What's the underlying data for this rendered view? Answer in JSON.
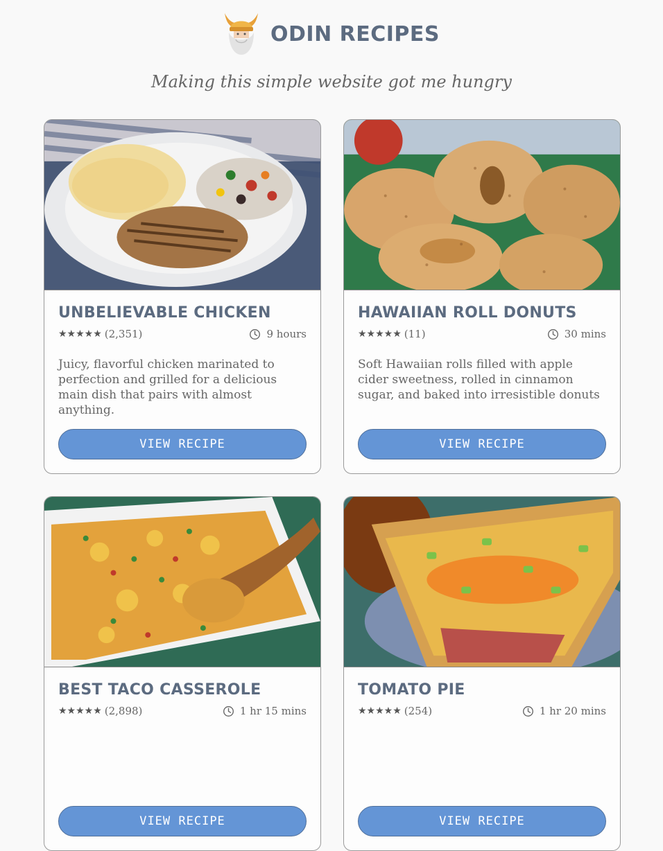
{
  "header": {
    "brand": "ODIN RECIPES",
    "logo_icon": "viking-helmet-logo-icon",
    "tagline": "Making this simple website got me hungry"
  },
  "colors": {
    "background": "#f9f9f9",
    "heading": "#5c6b80",
    "button": "#6495d6",
    "text": "#666666"
  },
  "recipes": [
    {
      "title": "Unbelievable Chicken",
      "stars": "★★★★★",
      "reviews": "(2,351)",
      "time_icon": "clock-icon",
      "time": "9 hours",
      "description": "Juicy, flavorful chicken marinated to perfection and grilled for a delicious main dish that pairs with almost anything.",
      "button_label": "View Recipe"
    },
    {
      "title": "Hawaiian Roll Donuts",
      "stars": "★★★★★",
      "reviews": "(11)",
      "time_icon": "clock-icon",
      "time": "30 mins",
      "description": "Soft Hawaiian rolls filled with apple cider sweetness, rolled in cinnamon sugar, and baked into irresistible donuts",
      "button_label": "View Recipe"
    },
    {
      "title": "Best Taco Casserole",
      "stars": "★★★★★",
      "reviews": "(2,898)",
      "time_icon": "clock-icon",
      "time": "1 hr 15 mins",
      "description": "",
      "button_label": "View Recipe"
    },
    {
      "title": "Tomato Pie",
      "stars": "★★★★★",
      "reviews": "(254)",
      "time_icon": "clock-icon",
      "time": "1 hr 20 mins",
      "description": "",
      "button_label": "View Recipe"
    }
  ]
}
